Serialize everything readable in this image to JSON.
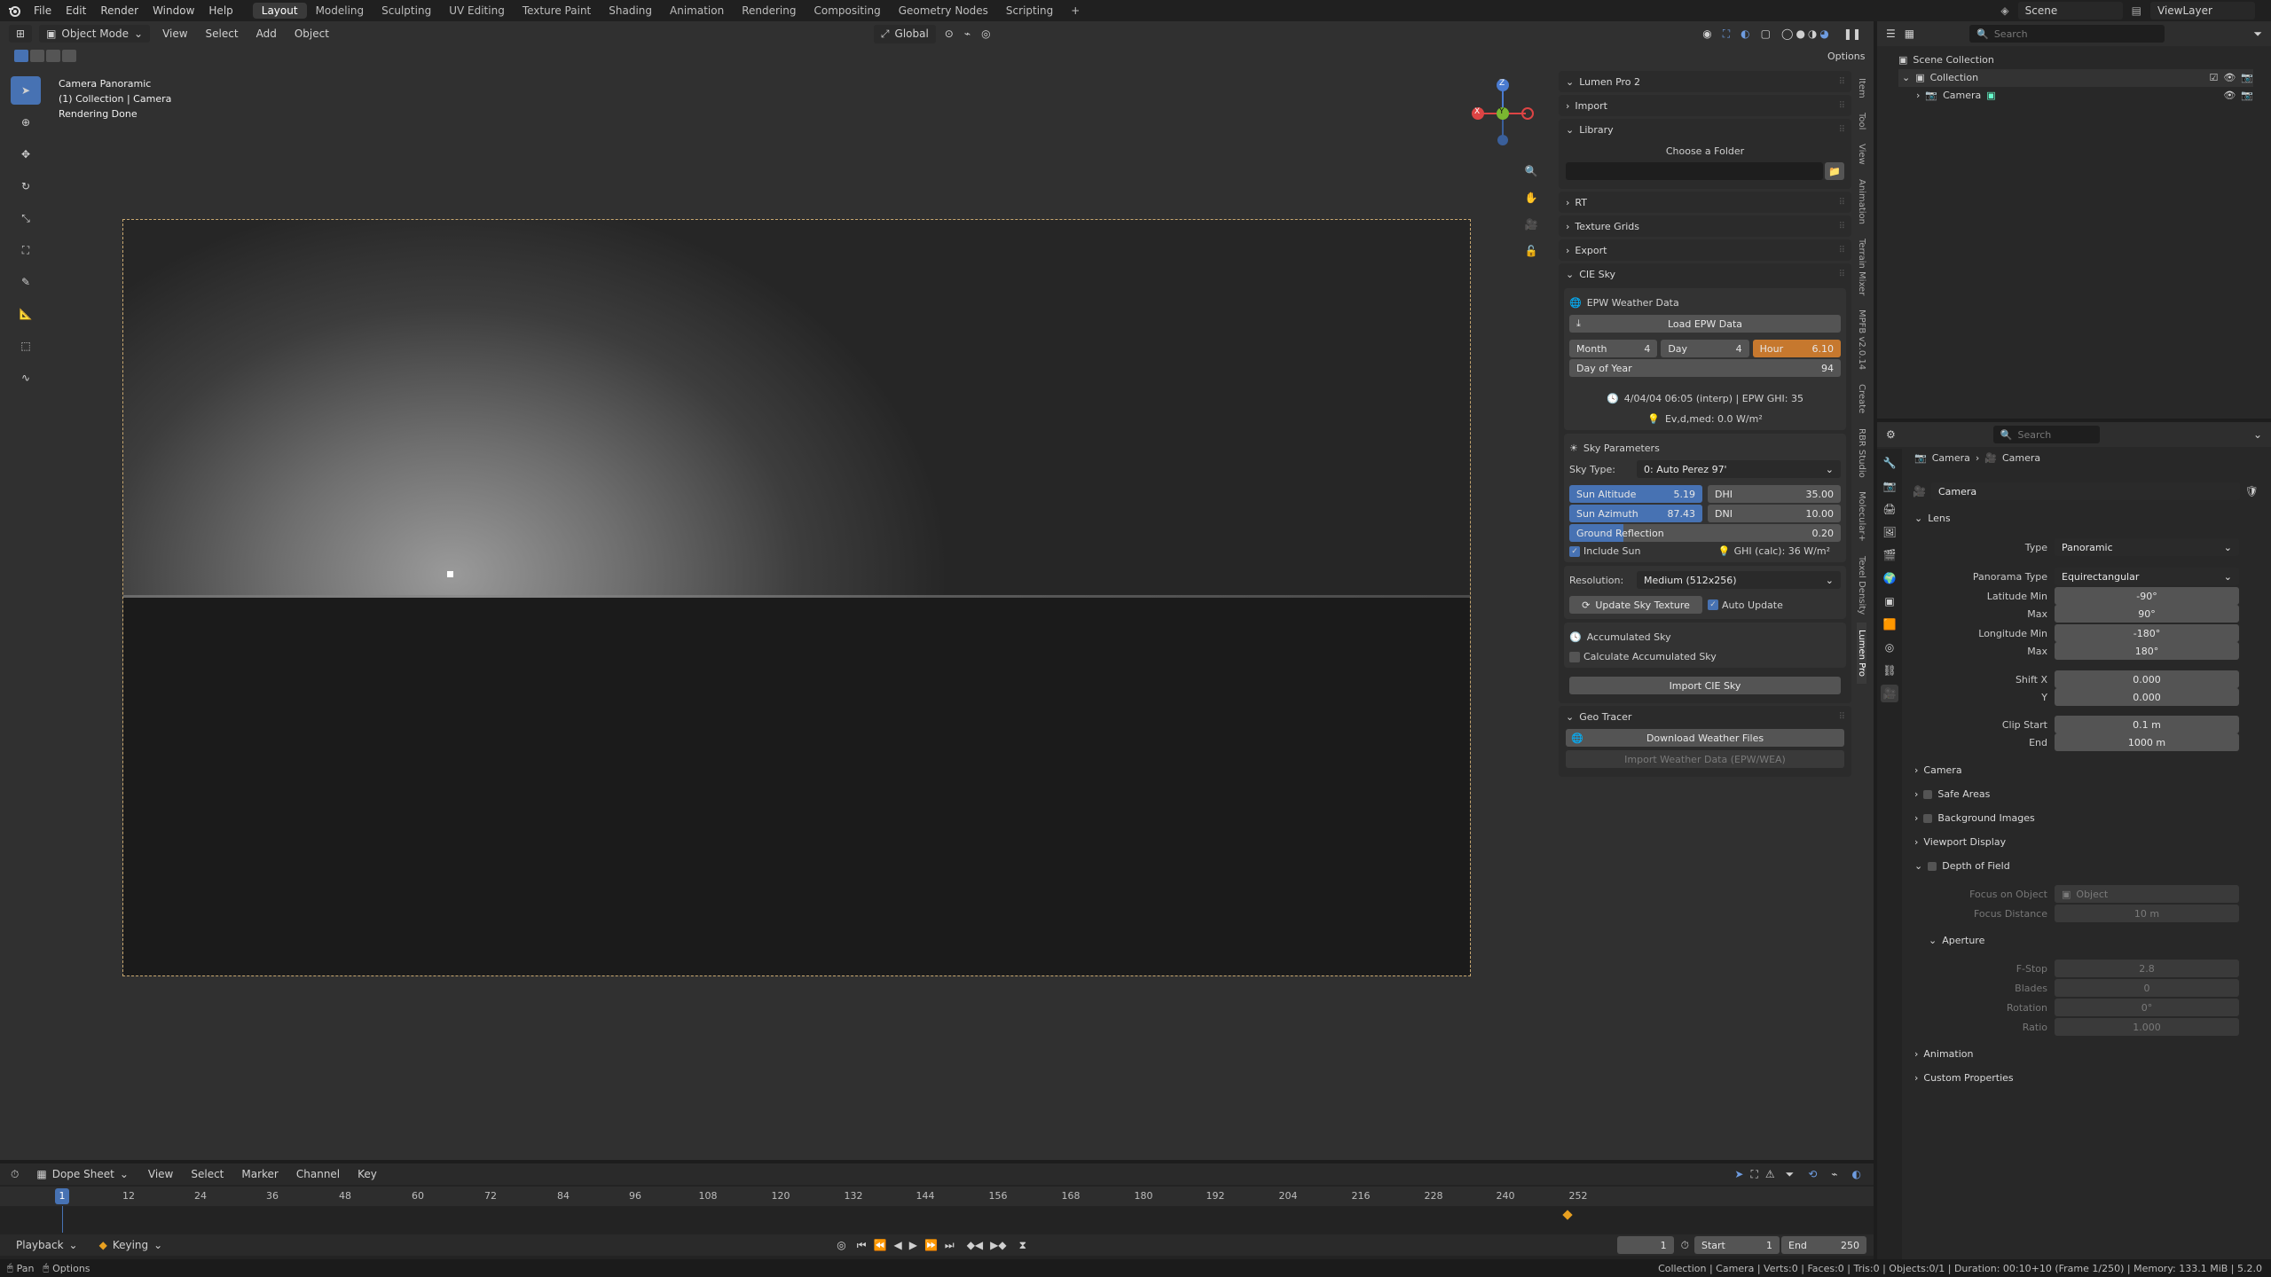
{
  "topbar": {
    "menus": [
      "File",
      "Edit",
      "Render",
      "Window",
      "Help"
    ],
    "workspaces": [
      "Layout",
      "Modeling",
      "Sculpting",
      "UV Editing",
      "Texture Paint",
      "Shading",
      "Animation",
      "Rendering",
      "Compositing",
      "Geometry Nodes",
      "Scripting"
    ],
    "active_workspace": "Layout",
    "add_tab": "+",
    "scene": "Scene",
    "view_layer": "ViewLayer"
  },
  "viewport": {
    "mode": "Object Mode",
    "menus": [
      "View",
      "Select",
      "Add",
      "Object"
    ],
    "orientation": "Global",
    "options_label": "Options",
    "info_line1": "Camera Panoramic",
    "info_line2": "(1) Collection | Camera",
    "info_line3": "Rendering Done",
    "gizmo_x": "X",
    "gizmo_y": "Y",
    "gizmo_z": "Z"
  },
  "npanel": {
    "lumen_title": "Lumen Pro 2",
    "import": "Import",
    "library": "Library",
    "choose_folder": "Choose a Folder",
    "folder_path": "",
    "rt": "RT",
    "texture_grids": "Texture Grids",
    "export": "Export",
    "cie_sky": "CIE Sky",
    "epw_title": "EPW Weather Data",
    "load_epw": "Load EPW Data",
    "month_label": "Month",
    "month_val": "4",
    "day_label": "Day",
    "day_val": "4",
    "hour_label": "Hour",
    "hour_val": "6.10",
    "doy_label": "Day of Year",
    "doy_val": "94",
    "interp_info": "4/04/04 06:05 (interp) | EPW GHI: 35",
    "ev_info": "Ev,d,med: 0.0 W/m²",
    "sky_params": "Sky Parameters",
    "sky_type_label": "Sky Type:",
    "sky_type_val": "0: Auto Perez 97'",
    "sun_alt_label": "Sun Altitude",
    "sun_alt_val": "5.19",
    "dhi_label": "DHI",
    "dhi_val": "35.00",
    "sun_az_label": "Sun Azimuth",
    "sun_az_val": "87.43",
    "dni_label": "DNI",
    "dni_val": "10.00",
    "ground_refl_label": "Ground Reflection",
    "ground_refl_val": "0.20",
    "include_sun": "Include Sun",
    "ghi_calc": "GHI (calc): 36 W/m²",
    "resolution_label": "Resolution:",
    "resolution_val": "Medium (512x256)",
    "update_sky": "Update Sky Texture",
    "auto_update": "Auto Update",
    "accum_sky": "Accumulated Sky",
    "calc_accum": "Calculate Accumulated Sky",
    "import_cie": "Import CIE Sky",
    "geo_tracer": "Geo Tracer",
    "download_weather": "Download Weather Files",
    "import_weather": "Import Weather Data (EPW/WEA)"
  },
  "sidetabs": [
    "Item",
    "Tool",
    "View",
    "Animation",
    "Terrain Mixer",
    "MPFB v2.0.14",
    "Create",
    "RBR Studio",
    "Molecular+",
    "Texel Density",
    "Lumen Pro"
  ],
  "outliner": {
    "search_placeholder": "Search",
    "scene_collection": "Scene Collection",
    "collection": "Collection",
    "camera": "Camera"
  },
  "properties": {
    "search_placeholder": "Search",
    "breadcrumb_obj": "Camera",
    "breadcrumb_data": "Camera",
    "data_name": "Camera",
    "lens_section": "Lens",
    "type_label": "Type",
    "type_val": "Panoramic",
    "pano_type_label": "Panorama Type",
    "pano_type_val": "Equirectangular",
    "lat_min_label": "Latitude Min",
    "lat_min_val": "-90°",
    "lat_max_label": "Max",
    "lat_max_val": "90°",
    "lon_min_label": "Longitude Min",
    "lon_min_val": "-180°",
    "lon_max_label": "Max",
    "lon_max_val": "180°",
    "shift_x_label": "Shift X",
    "shift_x_val": "0.000",
    "shift_y_label": "Y",
    "shift_y_val": "0.000",
    "clip_start_label": "Clip Start",
    "clip_start_val": "0.1 m",
    "clip_end_label": "End",
    "clip_end_val": "1000 m",
    "camera_section": "Camera",
    "safe_areas": "Safe Areas",
    "background_images": "Background Images",
    "viewport_display": "Viewport Display",
    "dof": "Depth of Field",
    "focus_obj_label": "Focus on Object",
    "focus_obj_placeholder": "Object",
    "focus_dist_label": "Focus Distance",
    "focus_dist_val": "10 m",
    "aperture": "Aperture",
    "fstop_label": "F-Stop",
    "fstop_val": "2.8",
    "blades_label": "Blades",
    "blades_val": "0",
    "rotation_label": "Rotation",
    "rotation_val": "0°",
    "ratio_label": "Ratio",
    "ratio_val": "1.000",
    "animation": "Animation",
    "custom_props": "Custom Properties"
  },
  "timeline": {
    "editor": "Dope Sheet",
    "menus": [
      "View",
      "Select",
      "Marker",
      "Channel",
      "Key"
    ],
    "current_frame_marker": "1",
    "ticks": [
      "12",
      "24",
      "36",
      "48",
      "60",
      "72",
      "84",
      "96",
      "108",
      "120",
      "132",
      "144",
      "156",
      "168",
      "180",
      "192",
      "204",
      "216",
      "228",
      "240",
      "252"
    ],
    "playback": "Playback",
    "keying": "Keying",
    "current_frame": "1",
    "start_label": "Start",
    "start_val": "1",
    "end_label": "End",
    "end_val": "250"
  },
  "statusbar": {
    "pan": "Pan",
    "options": "Options",
    "stats": "Collection | Camera | Verts:0 | Faces:0 | Tris:0 | Objects:0/1 | Duration: 00:10+10 (Frame 1/250) | Memory: 133.1 MiB | 5.2.0"
  },
  "colors": {
    "accent_blue": "#4772b3",
    "hour_orange": "#c6782e",
    "camera_frame": "#c9a870"
  }
}
